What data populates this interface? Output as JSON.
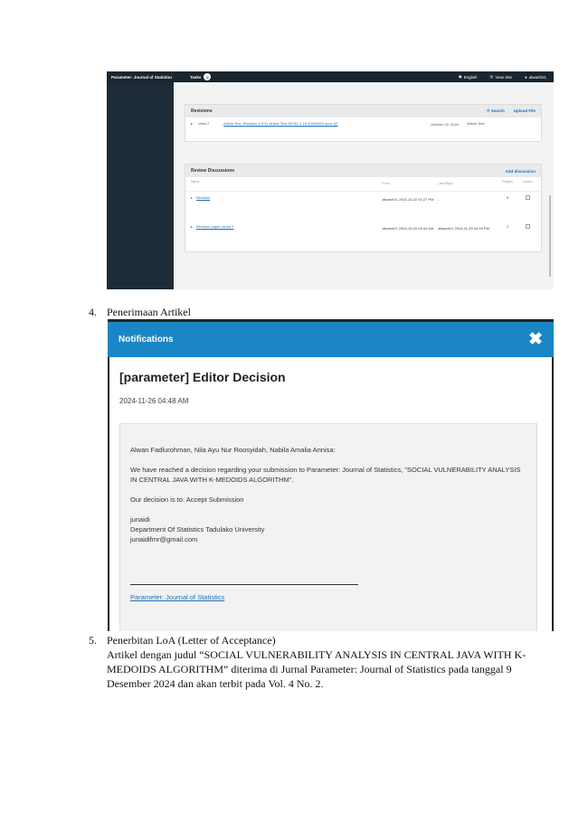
{
  "ojs": {
    "journal": "Parameter: Journal of Statistics",
    "tasks_label": "Tasks",
    "tasks_count": "0",
    "language": "English",
    "view_site": "View Site",
    "user": "alwanh21",
    "revisions": {
      "title": "Revisions",
      "search": "Search",
      "upload": "Upload File",
      "row": {
        "version": "Versi 2",
        "file": "Article Text, Revision 17131-Article Text-59782-1-15-20240823.docx (2)",
        "date": "October 22, 2024",
        "type": "Article Text"
      }
    },
    "discussions": {
      "title": "Review Discussions",
      "add": "Add discussion",
      "columns": [
        "Name",
        "From",
        "Last Reply",
        "Replies",
        "Closed"
      ],
      "rows": [
        {
          "name": "Revision",
          "from": "alwanh21 2024-10-22 01:27 PM",
          "last": "-",
          "replies": "0"
        },
        {
          "name": "Revision paper round 2",
          "from": "alwanh21 2024-10-29 04:44 AM",
          "last": "alwanh21 2024-11-25 04:29 PM",
          "replies": "2"
        }
      ]
    }
  },
  "doc": {
    "item4_num": "4.",
    "item4_label": "Penerimaan Artikel",
    "item5_num": "5.",
    "item5_label": "Penerbitan LoA (Letter of Acceptance)",
    "item5_text": "Artikel dengan judul “SOCIAL VULNERABILITY ANALYSIS IN CENTRAL JAVA WITH K-MEDOIDS ALGORITHM” diterima di Jurnal Parameter: Journal of Statistics pada tanggal 9 Desember 2024 dan akan terbit pada Vol. 4 No. 2."
  },
  "notification": {
    "header": "Notifications",
    "close": "✖",
    "title": "[parameter] Editor Decision",
    "date": "2024-11-26 04:48 AM",
    "greeting": "Alwan Fadlurohman, Nila Ayu Nur Roosyidah, Nabila Amalia Annisa:",
    "message": "We have reached a decision regarding your submission to Parameter: Journal of Statistics, \"SOCIAL VULNERABILITY ANALYSIS IN CENTRAL JAVA WITH K-MEDOIDS ALGORITHM\".",
    "decision": "Our decision is to: Accept Submission",
    "sig_name": "junaidi",
    "sig_dept": "Department Of Statistics Tadulako University",
    "sig_email": "junaidifmr@gmail.com",
    "journal_link": "Parameter: Journal of Statistics"
  }
}
